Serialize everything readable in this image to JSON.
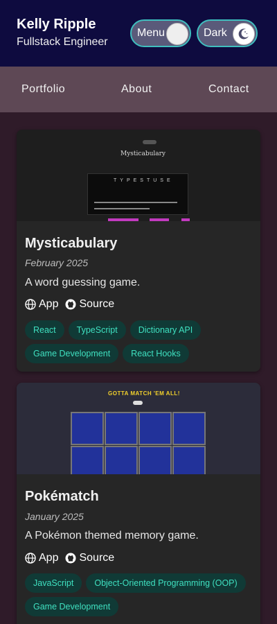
{
  "header": {
    "name": "Kelly Ripple",
    "role": "Fullstack Engineer",
    "menu_toggle_label": "Menu",
    "dark_toggle_label": "Dark"
  },
  "nav": {
    "items": [
      {
        "label": "Portfolio"
      },
      {
        "label": "About"
      },
      {
        "label": "Contact"
      }
    ]
  },
  "projects": [
    {
      "title": "Mysticabulary",
      "date": "February 2025",
      "description": "A word guessing game.",
      "app_label": "App",
      "source_label": "Source",
      "tags": [
        "React",
        "TypeScript",
        "Dictionary API",
        "Game Development",
        "React Hooks"
      ],
      "thumbnail": {
        "title": "Mysticabulary",
        "word": "TYPESTUSE"
      }
    },
    {
      "title": "Pokématch",
      "date": "January 2025",
      "description": "A Pokémon themed memory game.",
      "app_label": "App",
      "source_label": "Source",
      "tags": [
        "JavaScript",
        "Object-Oriented Programming (OOP)",
        "Game Development"
      ],
      "thumbnail": {
        "title": "GOTTA MATCH 'EM ALL!"
      }
    }
  ],
  "colors": {
    "header_bg": "#0e0b3f",
    "nav_bg": "#5e4855",
    "page_bg": "#2f1b29",
    "card_bg": "#262626",
    "tag_bg": "#103a36",
    "tag_text": "#3fe0c0",
    "toggle_border": "#3fbfbf"
  },
  "icons": {
    "app": "globe-icon",
    "source": "github-icon",
    "dark_mode": "moon-icon"
  }
}
